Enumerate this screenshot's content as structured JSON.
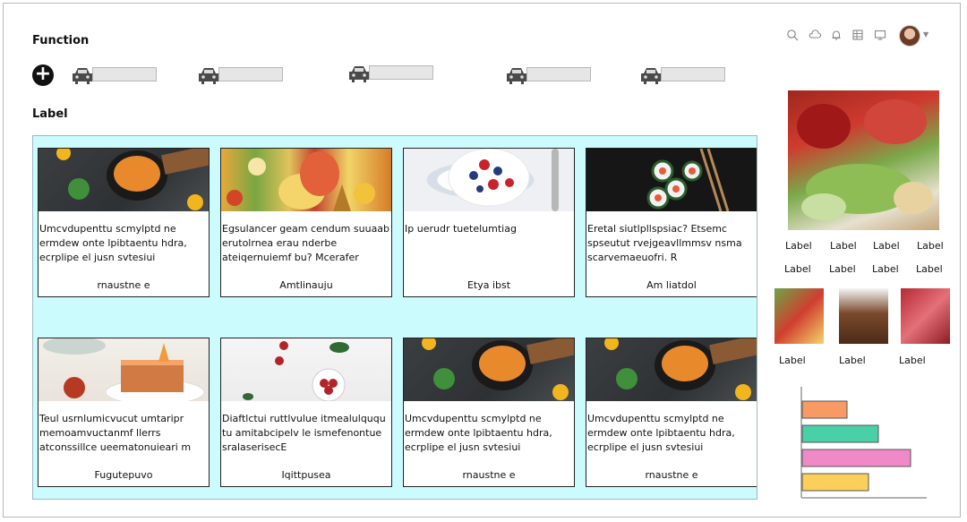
{
  "header": {
    "function_title": "Function",
    "label_title": "Label"
  },
  "function_items": [
    {
      "icon": "car-icon"
    },
    {
      "icon": "car-icon"
    },
    {
      "icon": "car-icon"
    },
    {
      "icon": "car-icon"
    },
    {
      "icon": "car-icon"
    }
  ],
  "toolbar_icons": [
    "search-icon",
    "cloud-icon",
    "bell-icon",
    "table-icon",
    "monitor-icon"
  ],
  "cards": [
    {
      "desc": "Umcvdupenttu scmylptd ne ermdew  onte lpibtaentu hdra, ecrplipe el jusn svtesiui",
      "name": "rnaustne e",
      "img": "img-dark"
    },
    {
      "desc": "Egsulancer geam cendum suuaab erutolrnea erau nderbe ateiqernuiemf bu? Mcerafer",
      "name": "Amtlinauju",
      "img": "img-fruit"
    },
    {
      "desc": "Ip  uerudr tuetelumtiag",
      "name": "Etya ibst",
      "img": "img-bowl"
    },
    {
      "desc": "Eretal  siutlpllspsiac? Etsemc spseutut rvejgeavllmmsv nsma scarvemaeuofri. R",
      "name": "Am liatdol",
      "img": "img-sushi"
    },
    {
      "desc": "Teul usrnlumicvucut umtaripr memoamvuctanmf llerrs atconssillce ueematonuieari m",
      "name": "Fugutepuvo",
      "img": "img-cake"
    },
    {
      "desc": "Diaftlctui ruttlvulue itmealulququ tu amitabcipelv le ismefenontue sralaserisecE",
      "name": "Iqittpusea",
      "img": "img-berry"
    },
    {
      "desc": "Umcvdupenttu scmylptd ne ermdew  onte lpibtaentu hdra, ecrplipe el jusn svtesiui",
      "name": "rnaustne e",
      "img": "img-dark"
    },
    {
      "desc": "Umcvdupenttu scmylptd ne ermdew  onte lpibtaentu hdra, ecrplipe el jusn svtesiui",
      "name": "rnaustne e",
      "img": "img-dark"
    }
  ],
  "side_labels_row1": [
    "Label",
    "Label",
    "Label",
    "Label"
  ],
  "side_labels_row2": [
    "Label",
    "Label",
    "Label",
    "Label"
  ],
  "thumb_labels": [
    "Label",
    "Label",
    "Label"
  ],
  "chart_data": {
    "type": "bar",
    "orientation": "horizontal",
    "categories": [
      "",
      "",
      "",
      ""
    ],
    "values": [
      0.35,
      0.6,
      0.85,
      0.52
    ],
    "colors": [
      "#f79a63",
      "#4ad0a6",
      "#ef8ac6",
      "#fbcf5a"
    ],
    "title": "",
    "xlabel": "",
    "ylabel": ""
  }
}
